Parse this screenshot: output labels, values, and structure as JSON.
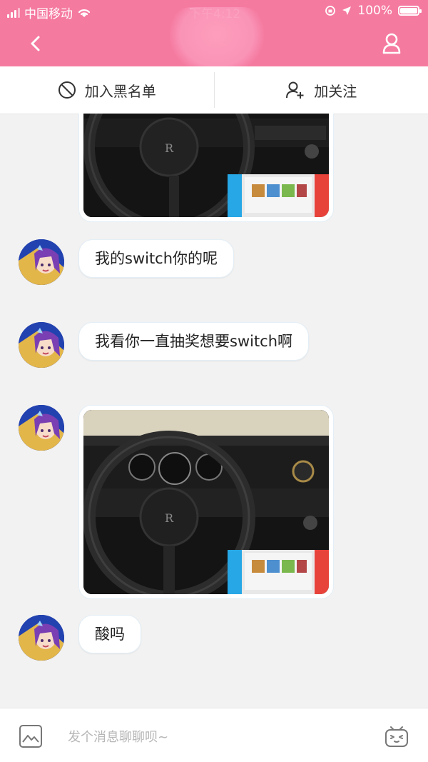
{
  "status_bar": {
    "carrier": "中国移动",
    "time": "下午4:12",
    "battery": "100%"
  },
  "nav": {
    "title": ""
  },
  "actions": {
    "blacklist_label": "加入黑名单",
    "follow_label": "加关注"
  },
  "messages": [
    {
      "type": "image"
    },
    {
      "type": "text",
      "text": "我的switch你的呢"
    },
    {
      "type": "text",
      "text": "我看你一直抽奖想要switch啊"
    },
    {
      "type": "image"
    },
    {
      "type": "text",
      "text": "酸吗"
    }
  ],
  "input": {
    "placeholder": "发个消息聊聊呗~"
  },
  "colors": {
    "header_pink": "#f57aa0",
    "background": "#f2f2f2",
    "bubble": "#ffffff"
  },
  "icons": [
    "back-icon",
    "profile-icon",
    "block-icon",
    "add-user-icon",
    "image-icon",
    "emoji-icon"
  ]
}
